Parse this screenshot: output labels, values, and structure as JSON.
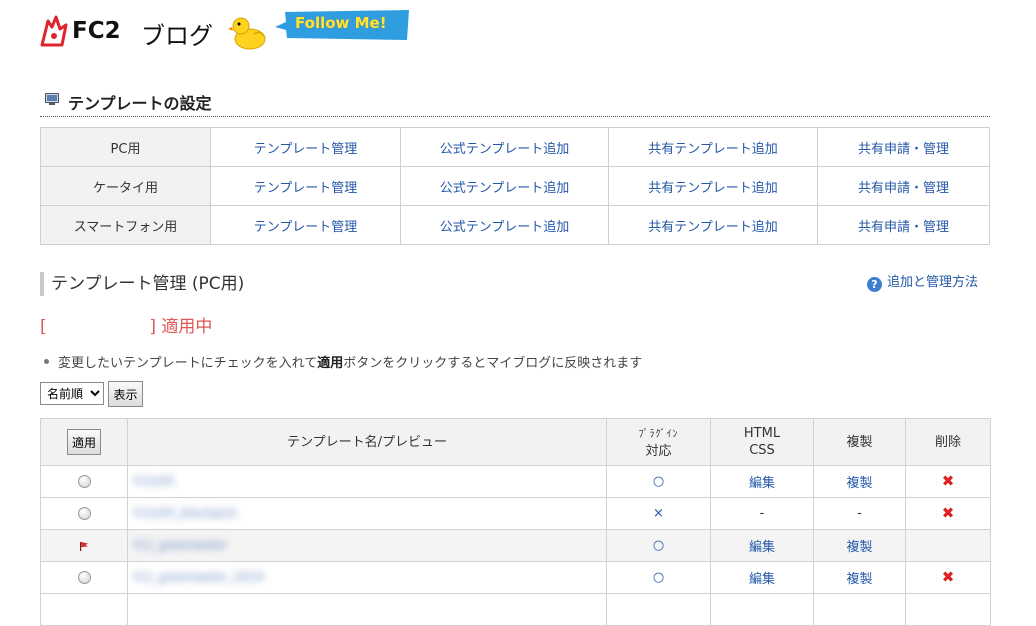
{
  "header": {
    "logo_text": "FC2",
    "blog_text": "ブログ",
    "follow_label": "Follow Me!"
  },
  "section": {
    "title": "テンプレートの設定"
  },
  "settings_rows": [
    {
      "label": "PC用",
      "links": [
        "テンプレート管理",
        "公式テンプレート追加",
        "共有テンプレート追加",
        "共有申請・管理"
      ]
    },
    {
      "label": "ケータイ用",
      "links": [
        "テンプレート管理",
        "公式テンプレート追加",
        "共有テンプレート追加",
        "共有申請・管理"
      ]
    },
    {
      "label": "スマートフォン用",
      "links": [
        "テンプレート管理",
        "公式テンプレート追加",
        "共有テンプレート追加",
        "共有申請・管理"
      ]
    }
  ],
  "manage": {
    "title": "テンプレート管理 (PC用)",
    "help_link": "追加と管理方法",
    "applied_open": "[",
    "applied_close": "] 適用中",
    "notice_before": "変更したいテンプレートにチェックを入れて",
    "notice_bold": "適用",
    "notice_after": "ボタンをクリックするとマイブログに反映されます",
    "sort_selected": "名前順",
    "show_button": "表示"
  },
  "table": {
    "headers": {
      "apply": "適用",
      "name": "テンプレート名/プレビュー",
      "plugin_line1": "ﾌﾟﾗｸﾞｲﾝ",
      "plugin_line2": "対応",
      "html_line1": "HTML",
      "html_line2": "CSS",
      "copy": "複製",
      "delete": "削除"
    },
    "rows": [
      {
        "name": "fc2v05",
        "plugin": "○",
        "html": "編集",
        "copy": "複製",
        "delete": true,
        "current": false
      },
      {
        "name": "fc2v05_blackjack",
        "plugin": "×",
        "html": "-",
        "copy": "-",
        "delete": true,
        "current": false
      },
      {
        "name": "fc2_greenwater",
        "plugin": "○",
        "html": "編集",
        "copy": "複製",
        "delete": false,
        "current": true
      },
      {
        "name": "fc2_greenwater_2019",
        "plugin": "○",
        "html": "編集",
        "copy": "複製",
        "delete": true,
        "current": false
      }
    ]
  },
  "colors": {
    "link": "#2458a8",
    "applied": "#e05555",
    "delete": "#e02020",
    "header_bg": "#f2f2f2"
  }
}
